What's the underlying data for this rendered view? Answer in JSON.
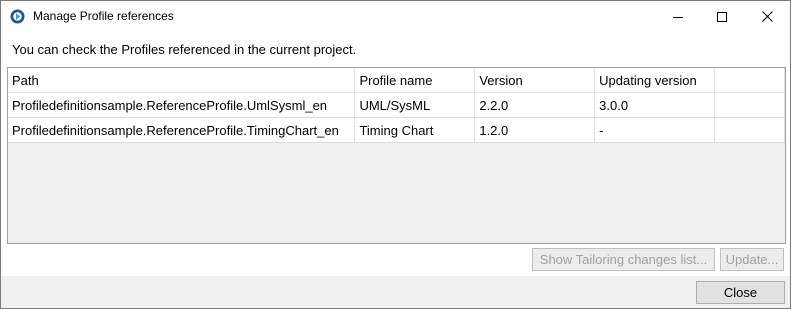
{
  "window": {
    "title": "Manage Profile references",
    "controls": {
      "minimize_icon": "minimize-icon",
      "maximize_icon": "maximize-icon",
      "close_icon": "close-icon"
    }
  },
  "intro_text": "You can check the Profiles referenced in the current project.",
  "table": {
    "headers": {
      "path": "Path",
      "profile_name": "Profile name",
      "version": "Version",
      "updating_version": "Updating version"
    },
    "rows": [
      {
        "path": "Profiledefinitionsample.ReferenceProfile.UmlSysml_en",
        "profile_name": "UML/SysML",
        "version": "2.2.0",
        "updating_version": "3.0.0"
      },
      {
        "path": "Profiledefinitionsample.ReferenceProfile.TimingChart_en",
        "profile_name": "Timing Chart",
        "version": "1.2.0",
        "updating_version": "-"
      }
    ]
  },
  "buttons": {
    "show_tailoring": "Show Tailoring changes list...",
    "update": "Update...",
    "close": "Close"
  },
  "colors": {
    "app_icon": "#1e5a8a",
    "disabled_text": "#a0a0a0"
  }
}
